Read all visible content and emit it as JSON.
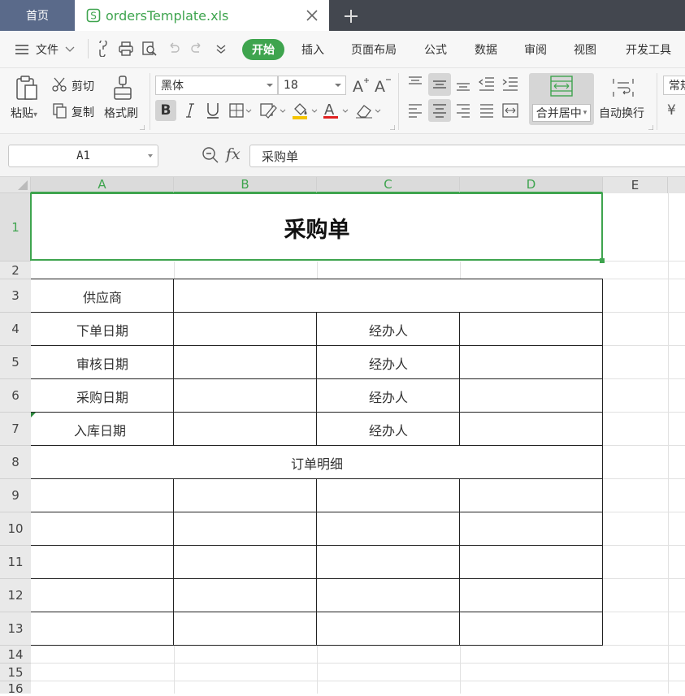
{
  "tabs": {
    "home": "首页",
    "file": "ordersTemplate.xls"
  },
  "menu": {
    "file": "文件",
    "items": [
      "开始",
      "插入",
      "页面布局",
      "公式",
      "数据",
      "审阅",
      "视图",
      "开发工具"
    ]
  },
  "ribbon": {
    "paste": "粘贴",
    "cut": "剪切",
    "copy": "复制",
    "format_painter": "格式刷",
    "font_name": "黑体",
    "font_size": "18",
    "merge_center": "合并居中",
    "wrap_text": "自动换行",
    "number_format": "常规",
    "currency_symbol": "¥"
  },
  "formula_bar": {
    "name_box": "A1",
    "fx": "fx",
    "formula": "采购单"
  },
  "sheet": {
    "columns": [
      "A",
      "B",
      "C",
      "D",
      "E"
    ],
    "rows": [
      "1",
      "2",
      "3",
      "4",
      "5",
      "6",
      "7",
      "8",
      "9",
      "10",
      "11",
      "12",
      "13",
      "14",
      "15",
      "16"
    ],
    "title": "采购单",
    "supplier_label": "供应商",
    "date_labels": [
      "下单日期",
      "审核日期",
      "采购日期",
      "入库日期"
    ],
    "handler_label": "经办人",
    "detail_label": "订单明细"
  },
  "colors": {
    "accent": "#3ea44e",
    "tabbar": "#43474f",
    "home_tab": "#5a6a8a"
  }
}
